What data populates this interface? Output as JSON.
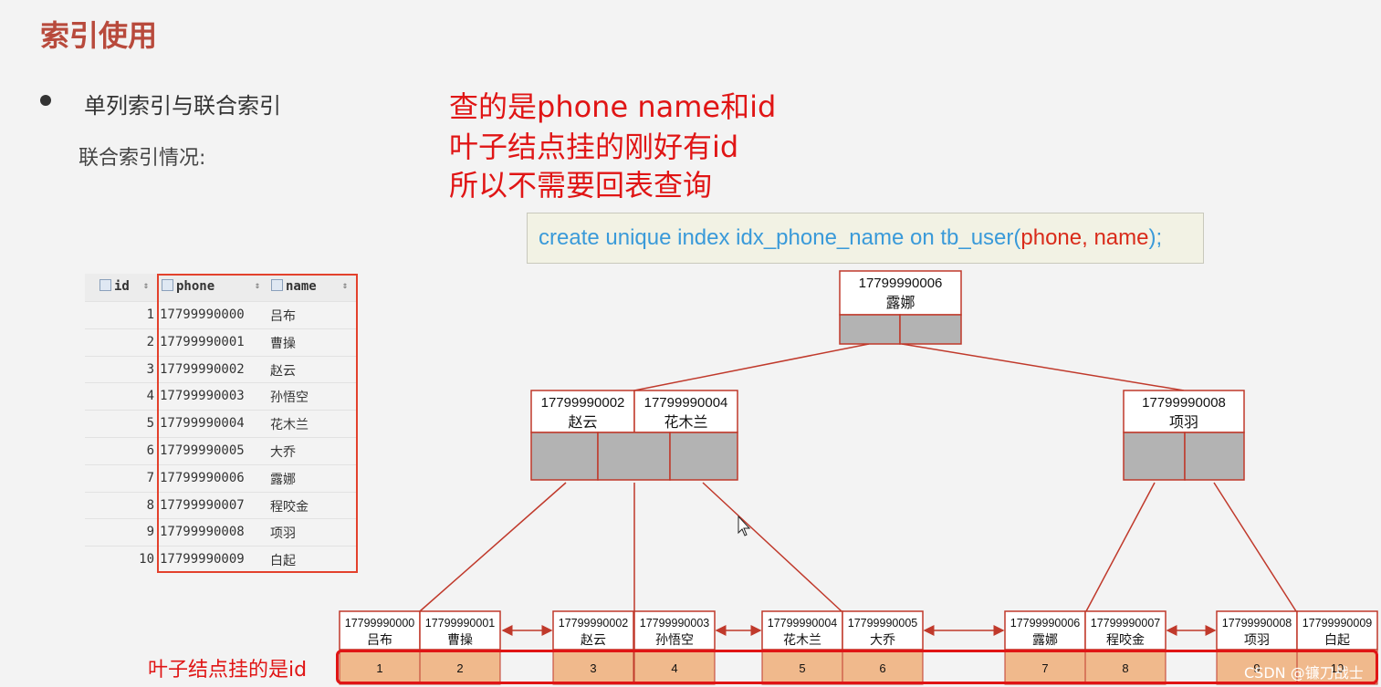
{
  "title": "索引使用",
  "bullet": "单列索引与联合索引",
  "subheading": "联合索引情况:",
  "annotations": [
    "查的是phone name和id",
    "叶子结点挂的刚好有id",
    "所以不需要回表查询"
  ],
  "sql": {
    "prefix": "create unique index idx_phone_name on tb_user(",
    "cols": "phone, name",
    "suffix": ");"
  },
  "table": {
    "headers": [
      "id",
      "phone",
      "name"
    ],
    "rows": [
      [
        "1",
        "17799990000",
        "吕布"
      ],
      [
        "2",
        "17799990001",
        "曹操"
      ],
      [
        "3",
        "17799990002",
        "赵云"
      ],
      [
        "4",
        "17799990003",
        "孙悟空"
      ],
      [
        "5",
        "17799990004",
        "花木兰"
      ],
      [
        "6",
        "17799990005",
        "大乔"
      ],
      [
        "7",
        "17799990006",
        "露娜"
      ],
      [
        "8",
        "17799990007",
        "程咬金"
      ],
      [
        "9",
        "17799990008",
        "项羽"
      ],
      [
        "10",
        "17799990009",
        "白起"
      ]
    ]
  },
  "tree": {
    "root": {
      "phone": "17799990006",
      "name": "露娜"
    },
    "left_node": [
      {
        "phone": "17799990002",
        "name": "赵云"
      },
      {
        "phone": "17799990004",
        "name": "花木兰"
      }
    ],
    "right_node": [
      {
        "phone": "17799990008",
        "name": "项羽"
      }
    ],
    "leaves": [
      {
        "phone": "17799990000",
        "name": "吕布",
        "id": "1"
      },
      {
        "phone": "17799990001",
        "name": "曹操",
        "id": "2"
      },
      {
        "phone": "17799990002",
        "name": "赵云",
        "id": "3"
      },
      {
        "phone": "17799990003",
        "name": "孙悟空",
        "id": "4"
      },
      {
        "phone": "17799990004",
        "name": "花木兰",
        "id": "5"
      },
      {
        "phone": "17799990005",
        "name": "大乔",
        "id": "6"
      },
      {
        "phone": "17799990006",
        "name": "露娜",
        "id": "7"
      },
      {
        "phone": "17799990007",
        "name": "程咬金",
        "id": "8"
      },
      {
        "phone": "17799990008",
        "name": "项羽",
        "id": "9"
      },
      {
        "phone": "17799990009",
        "name": "白起",
        "id": "10"
      }
    ]
  },
  "leaf_label": "叶子结点挂的是id",
  "watermark": "CSDN @镰刀战士",
  "colors": {
    "title": "#b84a3c",
    "annotation": "#e01515",
    "leaf_fill": "#f0b98c",
    "node_border": "#c0392b",
    "pointer_fill": "#b3b3b3"
  }
}
